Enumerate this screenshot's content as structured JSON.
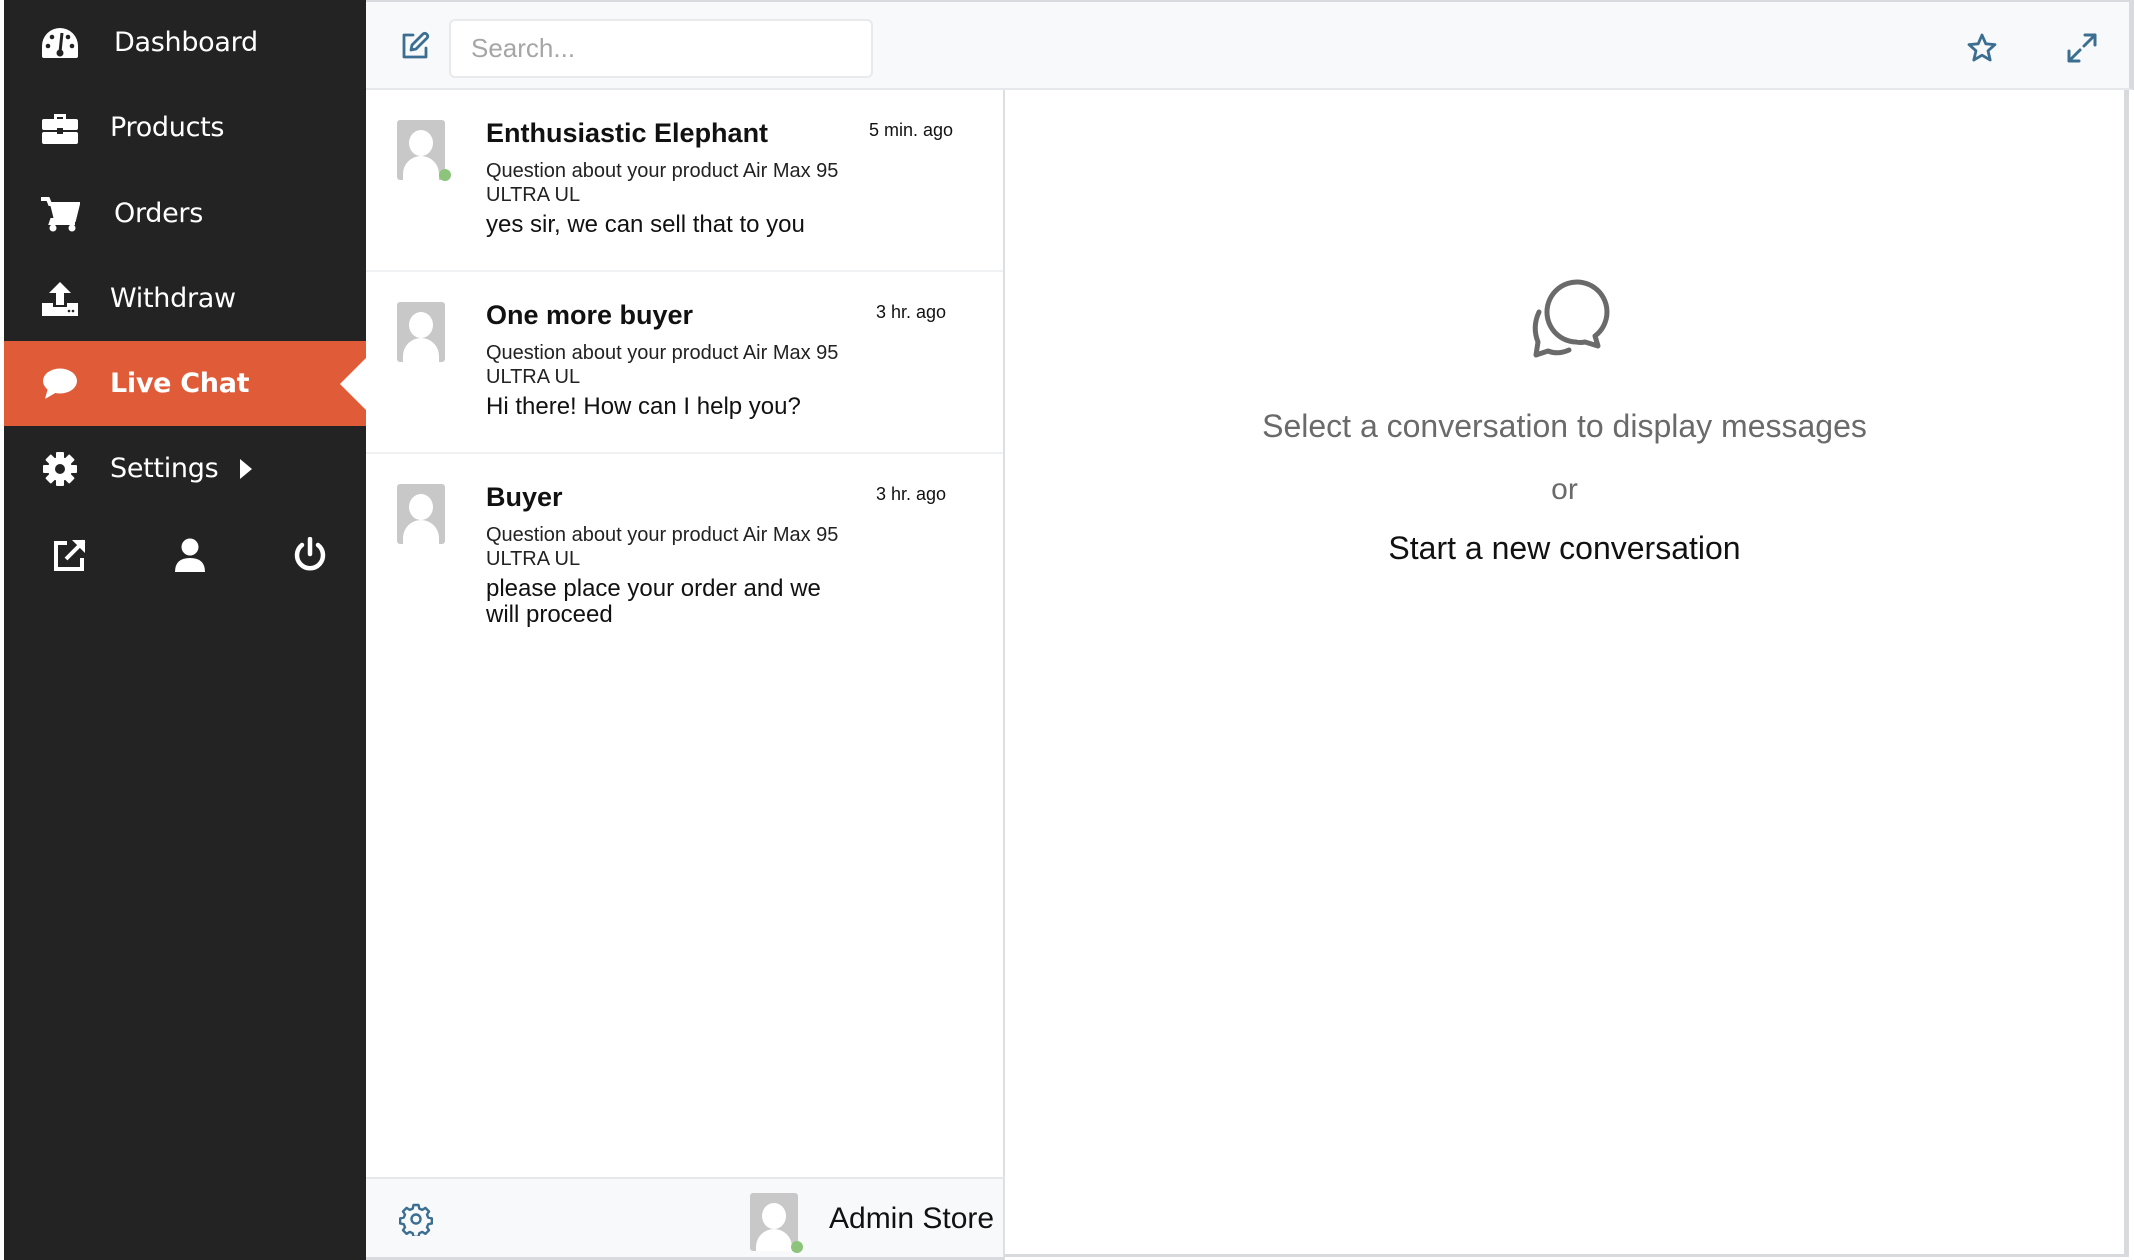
{
  "sidebar": {
    "items": [
      {
        "label": "Dashboard",
        "icon": "dashboard-gauge-icon",
        "active": false
      },
      {
        "label": "Products",
        "icon": "briefcase-icon",
        "active": false
      },
      {
        "label": "Orders",
        "icon": "shopping-cart-icon",
        "active": false
      },
      {
        "label": "Withdraw",
        "icon": "upload-icon",
        "active": false
      },
      {
        "label": "Live Chat",
        "icon": "chat-bubble-icon",
        "active": true
      },
      {
        "label": "Settings",
        "icon": "gear-icon",
        "active": false,
        "has_submenu": true
      }
    ],
    "quick_actions": [
      "external-link-icon",
      "user-icon",
      "power-icon"
    ],
    "colors": {
      "background": "#232323",
      "active": "#e05c38"
    }
  },
  "topbar": {
    "compose_icon": "compose-edit-icon",
    "search": {
      "placeholder": "Search...",
      "value": ""
    },
    "star_icon": "star-icon",
    "expand_icon": "expand-icon",
    "icon_color": "#3b6e91"
  },
  "conversations": [
    {
      "name": "Enthusiastic Elephant",
      "time": "5 min. ago",
      "subject": "Question about your product Air Max 95 ULTRA UL",
      "last_message": "yes sir, we can sell that to you",
      "online": true
    },
    {
      "name": "One more buyer",
      "time": "3 hr. ago",
      "subject": "Question about your product Air Max 95 ULTRA UL",
      "last_message": "Hi there! How can I help you?",
      "online": false
    },
    {
      "name": "Buyer",
      "time": "3 hr. ago",
      "subject": "Question about your product Air Max 95 ULTRA UL",
      "last_message": "please place your order and we will proceed",
      "online": false
    }
  ],
  "footer": {
    "settings_icon": "gear-outline-icon",
    "user_name": "Admin Store",
    "online": true
  },
  "empty_state": {
    "icon": "chat-bubbles-icon",
    "title": "Select a conversation to display messages",
    "or": "or",
    "cta": "Start a new conversation"
  }
}
